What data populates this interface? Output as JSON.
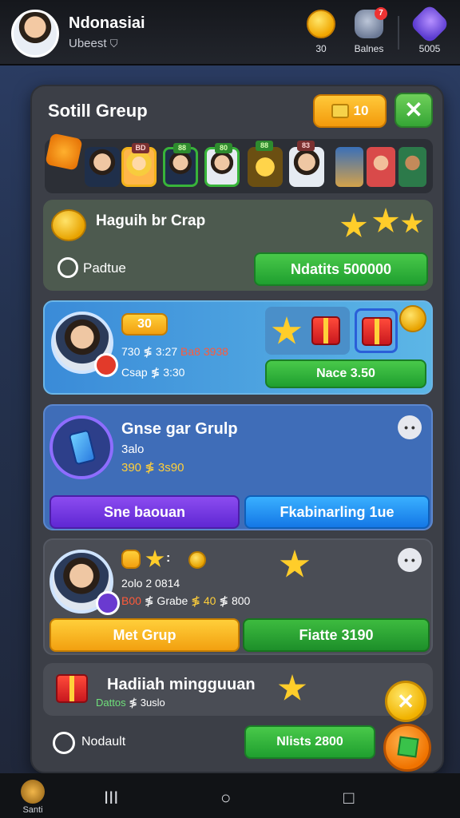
{
  "header": {
    "user_name": "Ndonasiai",
    "user_sub": "Ubeest",
    "coins_label": "30",
    "bank_label": "Balnes",
    "bank_badge": "7",
    "gems_label": "5005"
  },
  "panel": {
    "title": "Sotill Greup",
    "coin_button_label": "10",
    "close_label": "✕"
  },
  "strip": {
    "tags": [
      "BD",
      "88",
      "80",
      "88",
      "83"
    ]
  },
  "card_task": {
    "title": "Haguih br Crap",
    "sub_label": "Padtue",
    "button_label": "Ndatits 500000"
  },
  "card_player": {
    "level_chip": "30",
    "stats_line": "730 ≸ 3:27",
    "stats_red": "Ba8 3938",
    "group_line": "Csap ≸ 3:30",
    "button_label": "Nace 3.50"
  },
  "card_guide": {
    "title": "Gnse gar Grulp",
    "line1": "3alo",
    "line2": "390 ≸ 3s90",
    "left_button": "Sne baouan",
    "right_button": "Fkabinarling 1ue",
    "dots": "• •"
  },
  "card_member": {
    "icons_label": ":",
    "line1": "2olo 2 0814",
    "line2_red": "B00",
    "line2_mid": "≸ Grabe",
    "line2_gold": "≸ 40",
    "line2_end": "≸ 800",
    "left_button": "Met Grup",
    "right_button": "Fiatte 3190",
    "dots": "• •"
  },
  "card_weekly": {
    "title": "Hadiiah mingguuan",
    "sub_green": "Dattos",
    "sub_end": "≸ 3uslo"
  },
  "footer_row": {
    "label": "Nodault",
    "button_label": "Nlists 2800"
  },
  "fab": {
    "yellow_label": "✕"
  },
  "navbar": {
    "home_label": "Santi",
    "recent": "III",
    "home": "○",
    "back": "□"
  },
  "colors": {
    "accent_green": "#35a535",
    "accent_gold": "#f3b21b",
    "accent_purple": "#5f27d3",
    "accent_blue": "#1477e6"
  }
}
